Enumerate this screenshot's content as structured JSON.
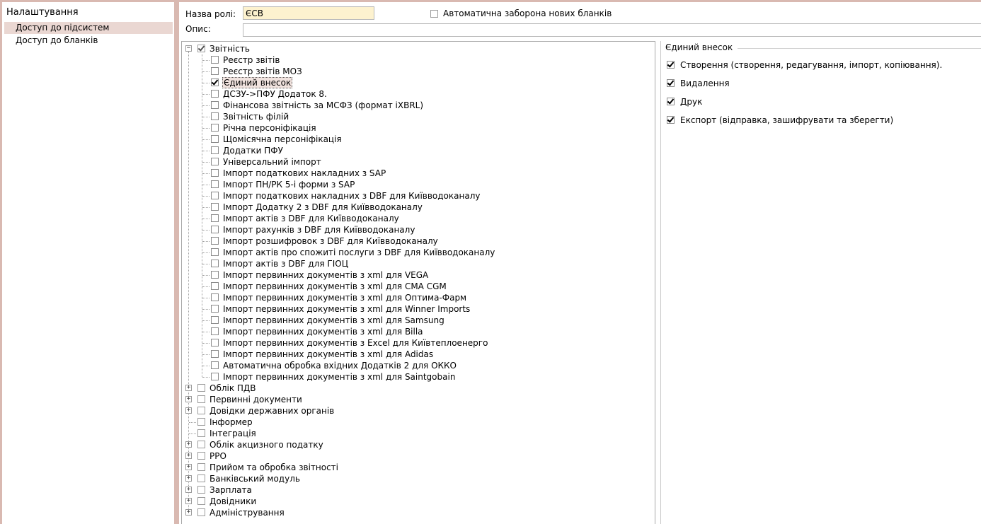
{
  "left_panel": {
    "title": "Налаштування",
    "items": [
      {
        "label": "Доступ до підсистем",
        "selected": true
      },
      {
        "label": "Доступ до бланків",
        "selected": false
      }
    ]
  },
  "form": {
    "role_label": "Назва ролі:",
    "role_value": "ЄСВ",
    "desc_label": "Опис:",
    "desc_value": "",
    "auto_block_label": "Автоматична заборона нових бланків",
    "auto_block_checked": false
  },
  "tree": {
    "root": {
      "label": "Звітність",
      "state": "partial",
      "expanded": true
    },
    "children": [
      {
        "label": "Реєстр звітів",
        "checked": false
      },
      {
        "label": "Реєстр звітів МОЗ",
        "checked": false
      },
      {
        "label": "Єдиний внесок",
        "checked": true,
        "selected": true
      },
      {
        "label": "ДСЗУ->ПФУ Додаток 8.",
        "checked": false
      },
      {
        "label": "Фінансова звітність за МСФЗ (формат iXBRL)",
        "checked": false
      },
      {
        "label": "Звітність філій",
        "checked": false
      },
      {
        "label": "Річна персоніфікація",
        "checked": false
      },
      {
        "label": "Щомісячна персоніфікація",
        "checked": false
      },
      {
        "label": "Додатки ПФУ",
        "checked": false
      },
      {
        "label": "Універсальний імпорт",
        "checked": false
      },
      {
        "label": "Імпорт податкових накладних з SAP",
        "checked": false
      },
      {
        "label": "Імпорт ПН/РК 5-і форми з SAP",
        "checked": false
      },
      {
        "label": "Імпорт податкових накладних з DBF для Київводоканалу",
        "checked": false
      },
      {
        "label": "Імпорт Додатку 2 з DBF для Київводоканалу",
        "checked": false
      },
      {
        "label": "Імпорт актів з DBF для Київводоканалу",
        "checked": false
      },
      {
        "label": "Імпорт рахунків з DBF для Київводоканалу",
        "checked": false
      },
      {
        "label": "Імпорт розшифровок з DBF для Київводоканалу",
        "checked": false
      },
      {
        "label": "Імпорт актів про спожиті послуги з DBF для Київводоканалу",
        "checked": false
      },
      {
        "label": "Імпорт актів з DBF для ГІОЦ",
        "checked": false
      },
      {
        "label": "Імпорт первинних документів з xml для VEGA",
        "checked": false
      },
      {
        "label": "Імпорт первинних документів з xml для CMA CGM",
        "checked": false
      },
      {
        "label": "Імпорт первинних документів з xml для Оптима-Фарм",
        "checked": false
      },
      {
        "label": "Імпорт первинних документів з xml для Winner Imports",
        "checked": false
      },
      {
        "label": "Імпорт первинних документів з xml для Samsung",
        "checked": false
      },
      {
        "label": "Імпорт первинних документів з xml для Billa",
        "checked": false
      },
      {
        "label": "Імпорт первинних документів з Excel для Київтеплоенерго",
        "checked": false
      },
      {
        "label": "Імпорт первинних документів з xml для Adidas",
        "checked": false
      },
      {
        "label": "Автоматична обробка вхідних Додатків 2 для ОККО",
        "checked": false
      },
      {
        "label": "Імпорт первинних документів з xml для Saintgobain",
        "checked": false
      }
    ],
    "top_nodes": [
      {
        "label": "Облік ПДВ",
        "expandable": true
      },
      {
        "label": "Первинні документи",
        "expandable": true
      },
      {
        "label": "Довідки державних органів",
        "expandable": true
      },
      {
        "label": "Інформер",
        "expandable": false
      },
      {
        "label": "Інтеграція",
        "expandable": false
      },
      {
        "label": "Облік акцизного податку",
        "expandable": true
      },
      {
        "label": "РРО",
        "expandable": true
      },
      {
        "label": "Прийом та обробка звітності",
        "expandable": true
      },
      {
        "label": "Банківський модуль",
        "expandable": true
      },
      {
        "label": "Зарплата",
        "expandable": true
      },
      {
        "label": "Довідники",
        "expandable": true
      },
      {
        "label": "Адміністрування",
        "expandable": true
      }
    ]
  },
  "permissions": {
    "group_title": "Єдиний внесок",
    "items": [
      {
        "label": "Створення (створення, редагування, імпорт, копіювання).",
        "checked": true
      },
      {
        "label": "Видалення",
        "checked": true
      },
      {
        "label": "Друк",
        "checked": true
      },
      {
        "label": "Експорт (відправка, зашифрувати та зберегти)",
        "checked": true
      }
    ]
  }
}
